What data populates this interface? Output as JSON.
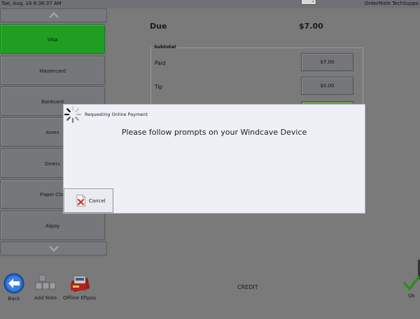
{
  "topbar": {
    "datetime": "Tue, Aug, 16  8:36:37 AM",
    "operator": "OrderMate TechSuppo"
  },
  "tenders": [
    {
      "label": "Visa",
      "active": true
    },
    {
      "label": "Mastercard",
      "active": false
    },
    {
      "label": "Bankcard",
      "active": false
    },
    {
      "label": "Amex",
      "active": false
    },
    {
      "label": "Diners",
      "active": false
    },
    {
      "label": "Paper Che",
      "active": false
    },
    {
      "label": "Alipay",
      "active": false
    }
  ],
  "payment": {
    "due_label": "Due",
    "due_value": "$7.00",
    "subtotal_label": "Subtotal",
    "paid_label": "Paid",
    "paid_value": "$7.00",
    "tip_label": "Tip",
    "tip_value": "$0.00"
  },
  "dialog": {
    "title": "Requesting Online Payment",
    "message": "Please follow prompts on your Windcave Device",
    "cancel_label": "Cancel"
  },
  "toolbar": {
    "back_label": "Back",
    "add_note_label": "Add Note",
    "offline_label": "Offline Eftpos",
    "mode_label": "CREDIT",
    "ok_label": "Ok"
  },
  "colors": {
    "active_tender": "#209e21",
    "background": "#7a7a7a",
    "dialog": "#eef0f6",
    "back_icon": "#1f5fbf",
    "ok_check": "#2e8b1f"
  }
}
